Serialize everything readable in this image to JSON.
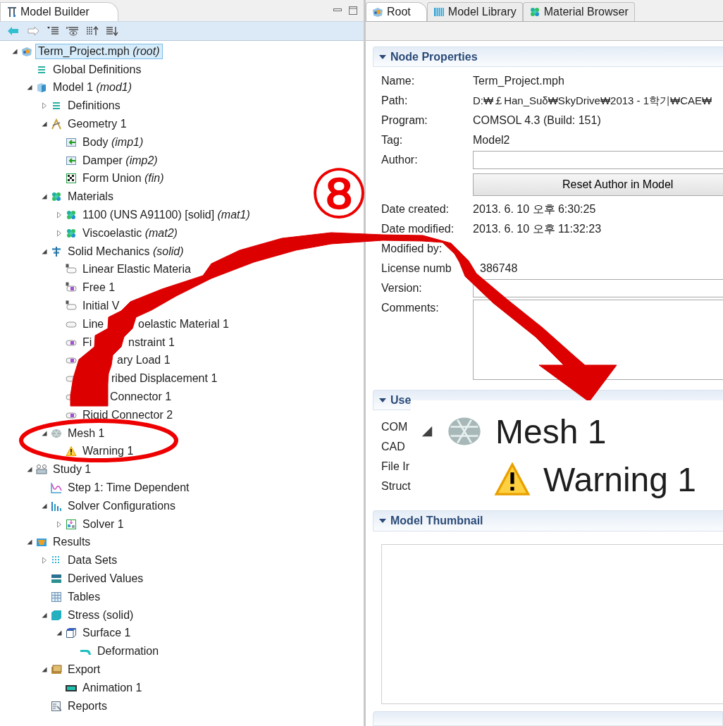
{
  "model_builder": {
    "title": "Model Builder",
    "tree": [
      {
        "label": "Term_Project.mph *(root)*",
        "kind": "root",
        "selected": true,
        "expanded": true,
        "children": [
          {
            "label": "Global Definitions",
            "kind": "list",
            "selected": false
          },
          {
            "label": "Model 1 *(mod1)*",
            "kind": "model",
            "selected": false,
            "expanded": true,
            "children": [
              {
                "label": "Definitions",
                "kind": "list",
                "selected": false,
                "expanded": false
              },
              {
                "label": "Geometry 1",
                "kind": "geometry",
                "selected": false,
                "expanded": true,
                "children": [
                  {
                    "label": "Body *(imp1)*",
                    "kind": "import",
                    "selected": false
                  },
                  {
                    "label": "Damper *(imp2)*",
                    "kind": "import",
                    "selected": false
                  },
                  {
                    "label": "Form Union *(fin)*",
                    "kind": "union",
                    "selected": false
                  }
                ]
              },
              {
                "label": "Materials",
                "kind": "material",
                "selected": false,
                "expanded": true,
                "children": [
                  {
                    "label": "1100 (UNS A91100) [solid] *(mat1)*",
                    "kind": "material",
                    "selected": false,
                    "expanded": false
                  },
                  {
                    "label": "Viscoelastic *(mat2)*",
                    "kind": "material",
                    "selected": false,
                    "expanded": false
                  }
                ]
              },
              {
                "label": "Solid Mechanics *(solid)*",
                "kind": "physics",
                "selected": false,
                "expanded": true,
                "children": [
                  {
                    "label": "Linear Elastic Materia",
                    "kind": "default-domain",
                    "selected": false
                  },
                  {
                    "label": "Free 1",
                    "kind": "default-boundary",
                    "selected": false
                  },
                  {
                    "label": "Initial V",
                    "kind": "default-domain",
                    "selected": false
                  },
                  {
                    "label": "Line",
                    "label_end": "oelastic Material 1",
                    "kind": "domain",
                    "selected": false
                  },
                  {
                    "label": "Fi",
                    "label_end": "nstraint 1",
                    "kind": "boundary",
                    "selected": false
                  },
                  {
                    "label_end": "ary Load 1",
                    "kind": "boundary",
                    "selected": false
                  },
                  {
                    "label_end": "ribed Displacement 1",
                    "kind": "domain",
                    "selected": false
                  },
                  {
                    "label_end": "Connector 1",
                    "kind": "boundary",
                    "selected": false
                  },
                  {
                    "label": "Rigid Connector 2",
                    "kind": "boundary",
                    "selected": false
                  }
                ]
              },
              {
                "label": "Mesh 1",
                "kind": "mesh",
                "selected": false,
                "expanded": true,
                "children": [
                  {
                    "label": "Warning 1",
                    "kind": "warning",
                    "selected": false
                  }
                ]
              }
            ]
          },
          {
            "label": "Study 1",
            "kind": "study",
            "selected": false,
            "expanded": true,
            "children": [
              {
                "label": "Step 1: Time Dependent",
                "kind": "step",
                "selected": false
              },
              {
                "label": "Solver Configurations",
                "kind": "solver-config",
                "selected": false,
                "expanded": true,
                "children": [
                  {
                    "label": "Solver 1",
                    "kind": "solver",
                    "selected": false,
                    "expanded": false
                  }
                ]
              }
            ]
          },
          {
            "label": "Results",
            "kind": "results",
            "selected": false,
            "expanded": true,
            "children": [
              {
                "label": "Data Sets",
                "kind": "datasets",
                "selected": false,
                "expanded": false
              },
              {
                "label": "Derived Values",
                "kind": "derived",
                "selected": false
              },
              {
                "label": "Tables",
                "kind": "tables",
                "selected": false
              },
              {
                "label": "Stress (solid)",
                "kind": "plot",
                "selected": false,
                "expanded": true,
                "children": [
                  {
                    "label": "Surface 1",
                    "kind": "surface",
                    "selected": false,
                    "expanded": true,
                    "children": [
                      {
                        "label": "Deformation",
                        "kind": "deformation",
                        "selected": false
                      }
                    ]
                  }
                ]
              },
              {
                "label": "Export",
                "kind": "export",
                "selected": false,
                "expanded": true,
                "children": [
                  {
                    "label": "Animation 1",
                    "kind": "animation",
                    "selected": false
                  }
                ]
              },
              {
                "label": "Reports",
                "kind": "reports",
                "selected": false
              }
            ]
          }
        ]
      }
    ]
  },
  "tabs": [
    {
      "label": "Root",
      "kind": "root",
      "selected": true
    },
    {
      "label": "Model Library",
      "kind": "library",
      "selected": false
    },
    {
      "label": "Material Browser",
      "kind": "material",
      "selected": false
    }
  ],
  "node_properties": {
    "title": "Node Properties",
    "fields": [
      {
        "label": "Name:",
        "kind": "text",
        "value": "Term_Project.mph"
      },
      {
        "label": "Path:",
        "kind": "text",
        "value": "D:₩￡Han_Suδ₩SkyDrive₩2013 - 1학기₩CAE₩"
      },
      {
        "label": "Program:",
        "kind": "text",
        "value": "COMSOL 4.3 (Build: 151)"
      },
      {
        "label": "Tag:",
        "kind": "text",
        "value": "Model2"
      },
      {
        "label": "Author:",
        "kind": "input"
      },
      {
        "label": "Reset Author in Model",
        "kind": "button"
      },
      {
        "label": "Date created:",
        "kind": "text",
        "value": "2013. 6. 10 오후 6:30:25"
      },
      {
        "label": "Date modified:",
        "kind": "text",
        "value": "2013. 6. 10 오후 11:32:23"
      },
      {
        "label": "Modified by:",
        "kind": "text"
      },
      {
        "label": "License numb",
        "kind": "text",
        "value": "386748"
      },
      {
        "label": "Version:",
        "kind": "input"
      },
      {
        "label": "Comments:",
        "kind": "textarea"
      }
    ]
  },
  "used_section": {
    "title": "Use",
    "rows": [
      "COM",
      "CAD",
      "File Ir",
      "Struct"
    ]
  },
  "model_thumbnail": {
    "title": "Model Thumbnail"
  },
  "annotation": {
    "number": "⑧",
    "inset": {
      "label": "Mesh 1",
      "expanded": true,
      "child": "Warning 1"
    }
  }
}
